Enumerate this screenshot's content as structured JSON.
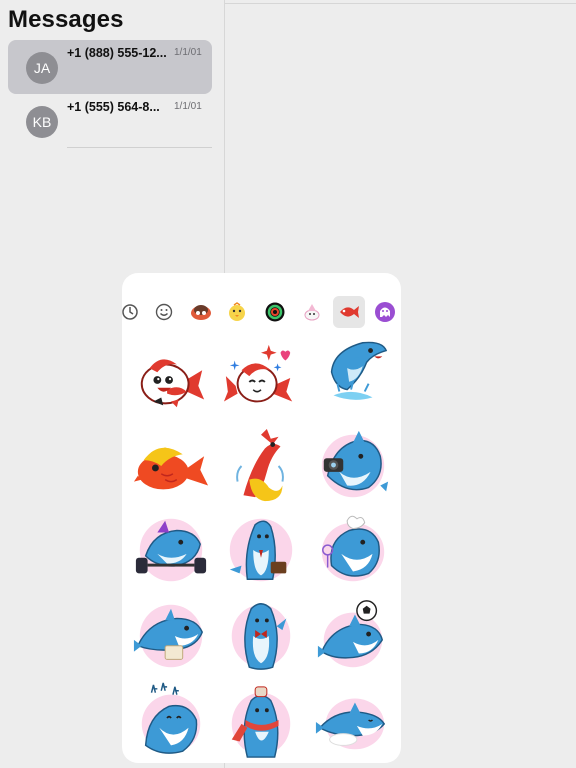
{
  "sidebar": {
    "title": "Messages",
    "conversations": [
      {
        "initials": "JA",
        "name": "+1 (888) 555-12...",
        "date": "1/1/01",
        "selected": true
      },
      {
        "initials": "KB",
        "name": "+1 (555) 564-8...",
        "date": "1/1/01",
        "selected": false
      }
    ]
  },
  "sticker_panel": {
    "tabs": [
      {
        "icon": "recent-clock-icon"
      },
      {
        "icon": "emoji-smiley-icon"
      },
      {
        "icon": "cartoon-pack-icon"
      },
      {
        "icon": "yellow-chick-pack-icon"
      },
      {
        "icon": "ring-pack-icon"
      },
      {
        "icon": "unicorn-pack-icon"
      },
      {
        "icon": "fish-pack-icon",
        "active": true
      },
      {
        "icon": "purple-ghost-pack-icon"
      }
    ],
    "stickers": [
      {
        "name": "koi-fish-smiling-sticker"
      },
      {
        "name": "koi-fish-hearts-sticker"
      },
      {
        "name": "shark-jumping-splash-sticker"
      },
      {
        "name": "goldfish-sticker"
      },
      {
        "name": "koi-fish-leaping-sticker"
      },
      {
        "name": "shark-camera-sticker"
      },
      {
        "name": "shark-weightlifting-sticker"
      },
      {
        "name": "shark-briefcase-sticker"
      },
      {
        "name": "shark-chef-sticker"
      },
      {
        "name": "shark-reading-sticker"
      },
      {
        "name": "shark-bowtie-sticker"
      },
      {
        "name": "shark-soccer-ball-sticker"
      },
      {
        "name": "shark-laughing-sticker"
      },
      {
        "name": "shark-scarf-sticker"
      },
      {
        "name": "shark-sleeping-sticker"
      }
    ],
    "colors": {
      "shark_blue": "#3d9ad6",
      "koi_red": "#e03a2f",
      "blob_pink": "#fbd6ea",
      "gold": "#f5c518"
    }
  }
}
